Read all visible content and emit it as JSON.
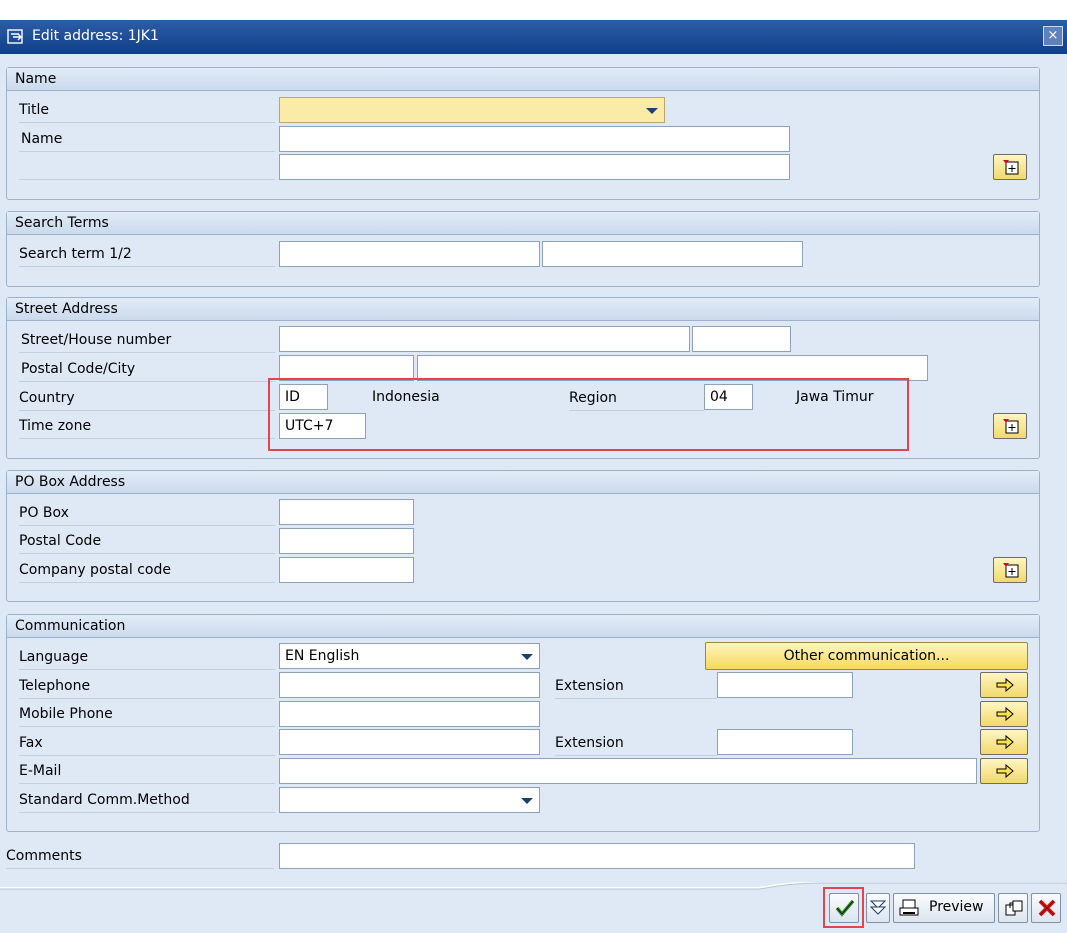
{
  "window": {
    "title": "Edit address:  1JK1",
    "close_glyph": "×"
  },
  "name_group": {
    "header": "Name",
    "title_label": "Title",
    "title_value": "",
    "name_label": "Name",
    "name_value": "",
    "name2_value": ""
  },
  "search_group": {
    "header": "Search Terms",
    "term_label": "Search term 1/2",
    "term1": "",
    "term2": ""
  },
  "street_group": {
    "header": "Street Address",
    "street_label": "Street/House number",
    "postal_city_label": "Postal Code/City",
    "country_label": "Country",
    "country_code": "ID",
    "country_name": "Indonesia",
    "region_label": "Region",
    "region_code": "04",
    "region_name": "Jawa Timur",
    "timezone_label": "Time zone",
    "timezone_value": "UTC+7"
  },
  "pobox_group": {
    "header": "PO Box Address",
    "pobox_label": "PO Box",
    "postal_label": "Postal Code",
    "company_postal_label": "Company postal code"
  },
  "comm_group": {
    "header": "Communication",
    "language_label": "Language",
    "language_value": "EN English",
    "other_comm_label": "Other communication...",
    "telephone_label": "Telephone",
    "extension_label": "Extension",
    "mobile_label": "Mobile Phone",
    "fax_label": "Fax",
    "fax_extension_label": "Extension",
    "email_label": "E-Mail",
    "std_method_label": "Standard Comm.Method",
    "std_method_value": ""
  },
  "comments": {
    "label": "Comments",
    "value": ""
  },
  "toolbar": {
    "preview_label": "Preview"
  },
  "icons": {
    "window": "edit-window-icon",
    "expand": "expand-fields-icon",
    "arrow": "yellow-arrow-icon",
    "check": "green-check-icon",
    "cancel": "red-cancel-icon"
  },
  "colors": {
    "highlight": "#e0474c",
    "required_field": "#faeba6",
    "titlebar": "#1a4b95"
  }
}
